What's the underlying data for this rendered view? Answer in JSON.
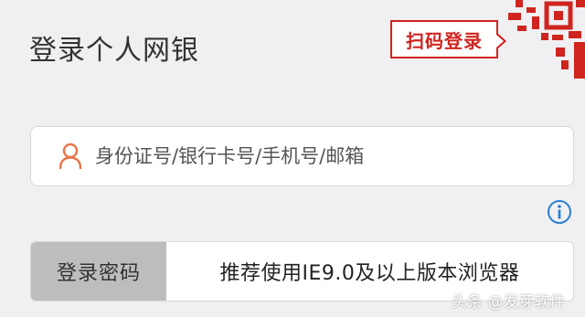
{
  "header": {
    "title": "登录个人网银",
    "scan_login_label": "扫码登录"
  },
  "account": {
    "icon": "user-icon",
    "placeholder": "身份证号/银行卡号/手机号/邮箱"
  },
  "info": {
    "icon": "info-icon"
  },
  "password": {
    "tab_label": "登录密码",
    "browser_tip": "推荐使用IE9.0及以上版本浏览器"
  },
  "watermark": "头条 @发芽软件",
  "colors": {
    "accent": "#d0241f",
    "info": "#2a7fd4",
    "user_icon": "#e8744a",
    "background": "#f0f0f2"
  }
}
